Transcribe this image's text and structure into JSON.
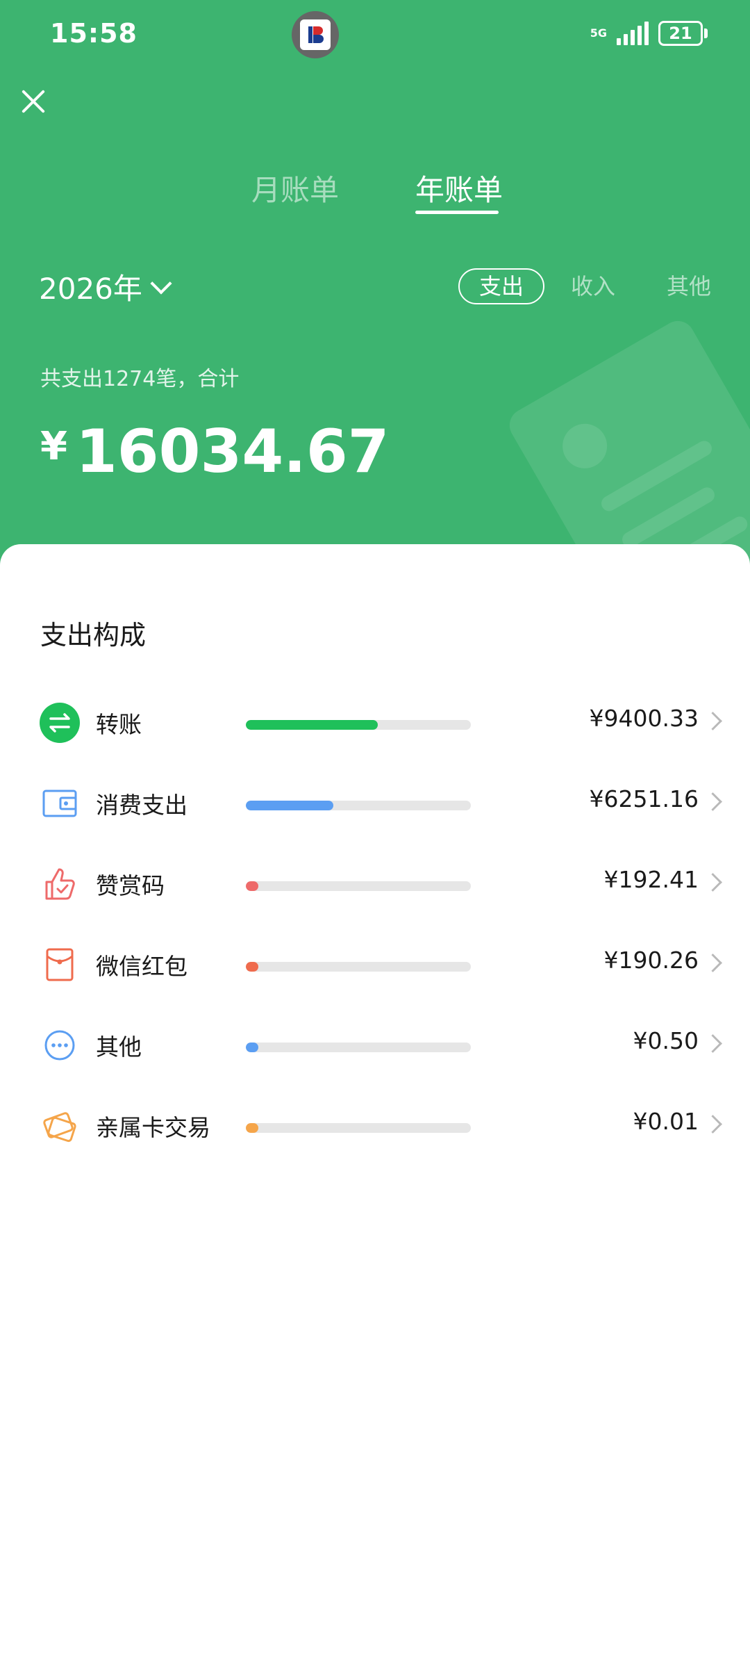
{
  "status_bar": {
    "time": "15:58",
    "network": "5G",
    "battery": "21"
  },
  "tabs": [
    {
      "label": "月账单",
      "active": false
    },
    {
      "label": "年账单",
      "active": true
    }
  ],
  "year_selector": {
    "label": "2026年"
  },
  "filters": [
    {
      "label": "支出",
      "active": true
    },
    {
      "label": "收入",
      "active": false
    },
    {
      "label": "其他",
      "active": false
    }
  ],
  "summary": {
    "label": "共支出1274笔，合计",
    "currency": "¥",
    "total": "16034.67"
  },
  "breakdown": {
    "title": "支出构成",
    "items": [
      {
        "label": "转账",
        "amount": "¥9400.33",
        "share": 0.5863,
        "color": "#1fc05a",
        "icon": "transfer-icon"
      },
      {
        "label": "消费支出",
        "amount": "¥6251.16",
        "share": 0.3899,
        "color": "#5b9ef2",
        "icon": "wallet-icon"
      },
      {
        "label": "赞赏码",
        "amount": "¥192.41",
        "share": 0.012,
        "color": "#ee6a6a",
        "icon": "thumbs-up-icon"
      },
      {
        "label": "微信红包",
        "amount": "¥190.26",
        "share": 0.0119,
        "color": "#ef6b4d",
        "icon": "red-envelope-icon"
      },
      {
        "label": "其他",
        "amount": "¥0.50",
        "share": 3e-05,
        "color": "#5b9ef2",
        "icon": "more-dots-icon"
      },
      {
        "label": "亲属卡交易",
        "amount": "¥0.01",
        "share": 1e-06,
        "color": "#f5a54a",
        "icon": "family-card-icon"
      }
    ]
  }
}
